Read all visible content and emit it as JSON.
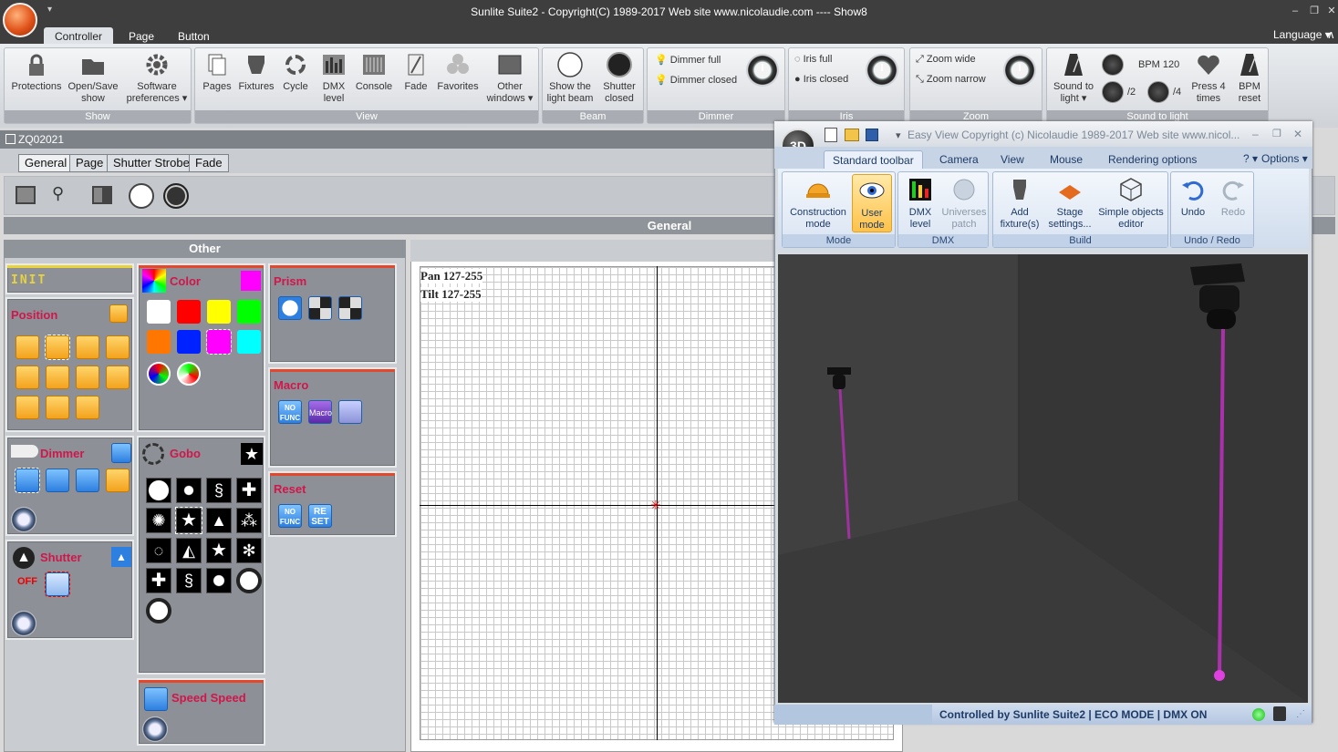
{
  "window": {
    "title": "Sunlite Suite2 - Copyright(C) 1989-2017    Web site www.nicolaudie.com ---- Show8",
    "language_label": "Language"
  },
  "menu_tabs": [
    "Controller",
    "Page",
    "Button"
  ],
  "ribbon": {
    "show": {
      "caption": "Show",
      "protections": "Protections",
      "open_save_1": "Open/Save",
      "open_save_2": "show",
      "software_1": "Software",
      "software_2": "preferences"
    },
    "view": {
      "caption": "View",
      "pages": "Pages",
      "fixtures": "Fixtures",
      "cycle": "Cycle",
      "dmx_1": "DMX",
      "dmx_2": "level",
      "console": "Console",
      "fade": "Fade",
      "favorites": "Favorites",
      "other_1": "Other",
      "other_2": "windows"
    },
    "beam": {
      "caption": "Beam",
      "show_1": "Show the",
      "show_2": "light beam",
      "shutter_1": "Shutter",
      "shutter_2": "closed"
    },
    "dimmer": {
      "caption": "Dimmer",
      "full": "Dimmer full",
      "closed": "Dimmer closed"
    },
    "iris": {
      "caption": "Iris",
      "full": "Iris full",
      "closed": "Iris closed"
    },
    "zoom": {
      "caption": "Zoom",
      "wide": "Zoom wide",
      "narrow": "Zoom narrow"
    },
    "sound": {
      "caption": "Sound to light",
      "sound_1": "Sound to",
      "sound_2": "light",
      "bpm": "BPM 120",
      "div2": "/2",
      "div4": "/4",
      "press_1": "Press 4",
      "press_2": "times",
      "bpm_reset_1": "BPM",
      "bpm_reset_2": "reset"
    }
  },
  "document": {
    "title": "ZQ02021"
  },
  "sub_tabs": [
    "General",
    "Page",
    "Shutter Strobe",
    "Fade"
  ],
  "general_label": "General",
  "other_panel": {
    "title": "Other",
    "init": "INIT",
    "position": "Position",
    "color": "Color",
    "prism": "Prism",
    "macro": "Macro",
    "dimmer": "Dimmer",
    "gobo": "Gobo",
    "reset": "Reset",
    "shutter": "Shutter",
    "speed": "Speed Speed",
    "no_func": "NO FUNC",
    "macro_btn": "Macro",
    "reset_btn": "RE SET",
    "off": "OFF"
  },
  "colors": [
    "#ffffff",
    "#ff0000",
    "#ffff00",
    "#00ff00",
    "#ff7700",
    "#0022ff",
    "#ff00ff",
    "#00ffff"
  ],
  "grid": {
    "pan": "Pan 127-255",
    "tilt": "Tilt 127-255"
  },
  "easyview": {
    "title": "Easy View   Copyright (c) Nicolaudie 1989-2017    Web site www.nicol...",
    "tabs": [
      "Standard toolbar",
      "Camera",
      "View",
      "Mouse",
      "Rendering options"
    ],
    "help": "?",
    "options": "Options",
    "mode": {
      "caption": "Mode",
      "construction_1": "Construction",
      "construction_2": "mode",
      "user_1": "User",
      "user_2": "mode"
    },
    "dmx": {
      "caption": "DMX",
      "dmx_1": "DMX",
      "dmx_2": "level",
      "universes_1": "Universes",
      "universes_2": "patch"
    },
    "build": {
      "caption": "Build",
      "add_1": "Add",
      "add_2": "fixture(s)",
      "stage_1": "Stage",
      "stage_2": "settings...",
      "simple_1": "Simple objects",
      "simple_2": "editor"
    },
    "undo": {
      "caption": "Undo / Redo",
      "undo": "Undo",
      "redo": "Redo"
    },
    "status": "Controlled by Sunlite Suite2   |   ECO MODE   |   DMX ON"
  }
}
